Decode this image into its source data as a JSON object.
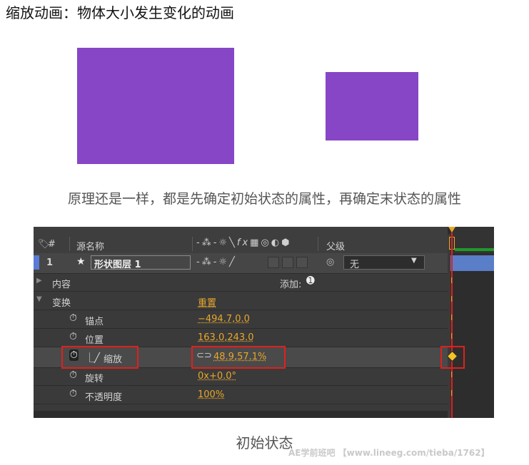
{
  "heading": "缩放动画：物体大小发生变化的动画",
  "principle": "原理还是一样，都是先确定初始状态的属性，再确定末状态的属性",
  "caption": "初始状态",
  "watermark": "AE学前班吧 【www.lineeg.com/tieba/1762】",
  "colors": {
    "shape_fill": "#8646c6",
    "value_orange": "#e8a72b",
    "highlight_red": "#e0201c",
    "panel_bg": "#3a3a3a"
  },
  "panel": {
    "header": {
      "num": "#",
      "source_name": "源名称",
      "parent": "父级"
    },
    "layer": {
      "index": "1",
      "name": "形状图层 1",
      "parent_value": "无"
    },
    "contents": {
      "label": "内容",
      "add_label": "添加:"
    },
    "transform": {
      "label": "变换",
      "reset": "重置"
    },
    "props": [
      {
        "name": "锚点",
        "value": "−494.7,0.0"
      },
      {
        "name": "位置",
        "value": "163.0,243.0"
      },
      {
        "name": "缩放",
        "value": "48.9,57.1%"
      },
      {
        "name": "旋转",
        "value": "0x+0.0°"
      },
      {
        "name": "不透明度",
        "value": "100%"
      }
    ]
  }
}
